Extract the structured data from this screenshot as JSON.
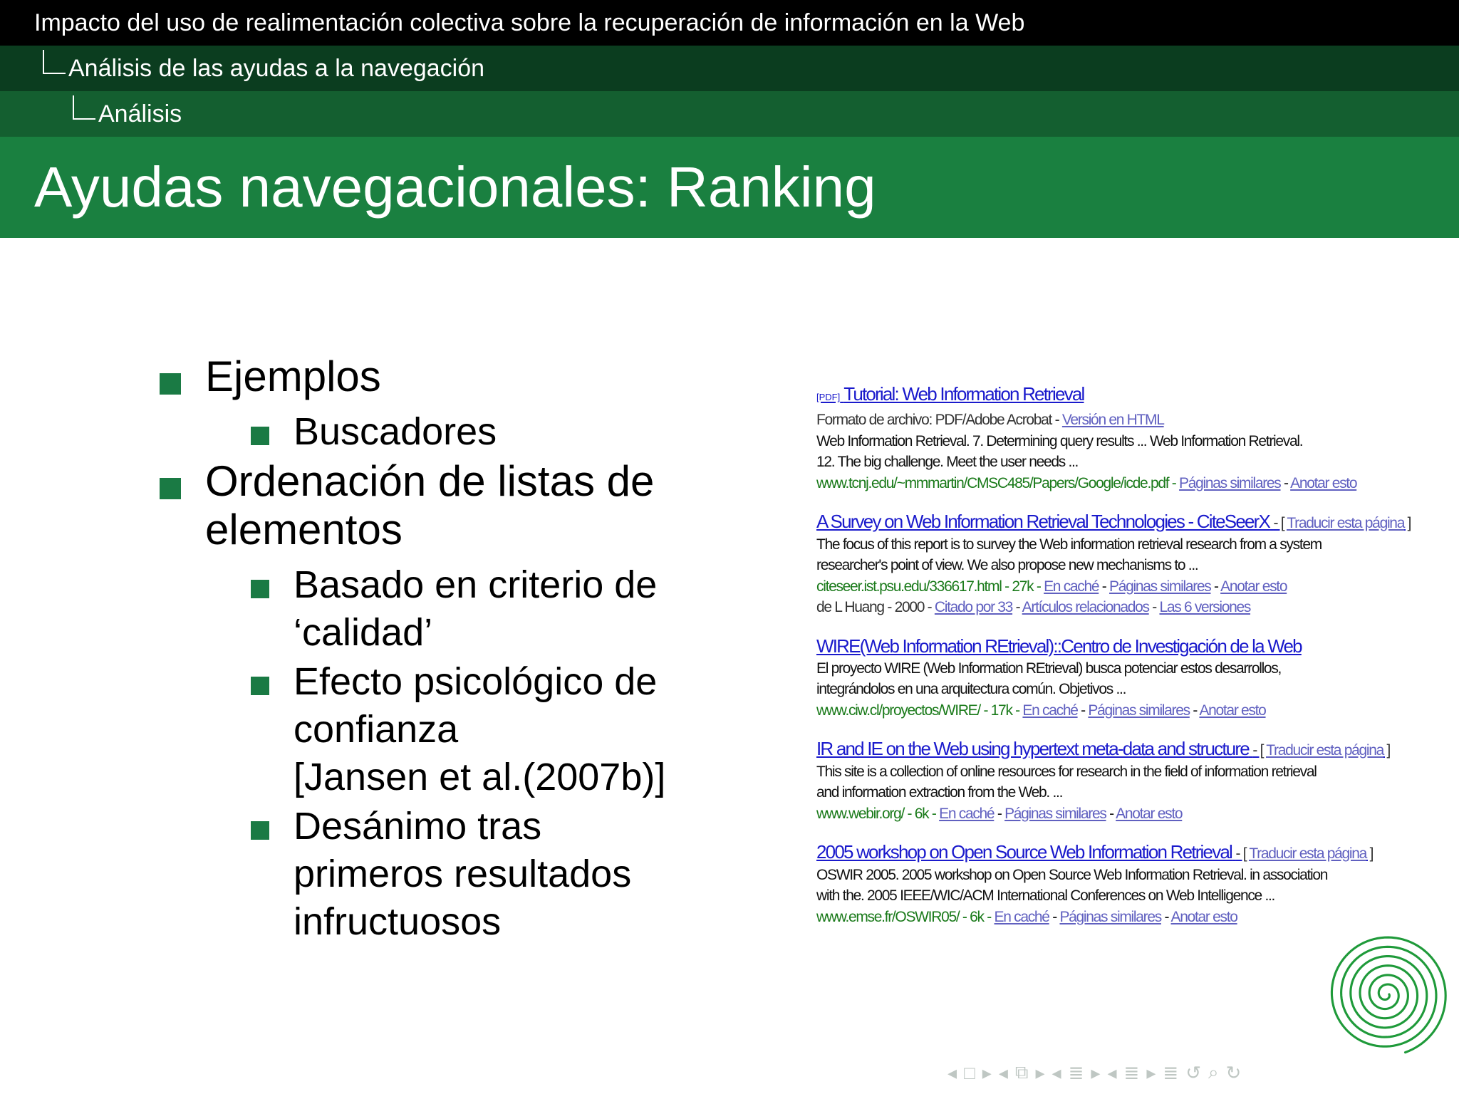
{
  "header": {
    "presentation_title": "Impacto del uso de realimentación colectiva sobre la recuperación de información en la Web",
    "section": "Análisis de las ayudas a la navegación",
    "subsection": "Análisis",
    "frame_title": "Ayudas navegacionales: Ranking"
  },
  "bullets": {
    "b1": "Ejemplos",
    "b1_1": "Buscadores",
    "b2_line1": "Ordenación de listas de",
    "b2_line2": "elementos",
    "b2_1_line1": "Basado en criterio de",
    "b2_1_line2": "‘calidad’",
    "b2_2_line1": "Efecto psicológico de",
    "b2_2_line2": "confianza",
    "b2_2_line3": "[Jansen et al.(2007b)]",
    "b2_3_line1": "Desánimo tras",
    "b2_3_line2": "primeros resultados",
    "b2_3_line3": "infructuosos"
  },
  "search_results": {
    "r1": {
      "pdf_tag": "[PDF]",
      "title": "Tutorial: Web Information Retrieval",
      "format_label": "Formato de archivo: PDF/Adobe Acrobat -",
      "format_link": "Versión en HTML",
      "snippet1": "Web Information Retrieval. 7. Determining query results ... Web Information Retrieval.",
      "snippet2": "12. The big challenge. Meet the user needs ...",
      "url": "www.tcnj.edu/~mmmartin/CMSC485/Papers/Google/icde.pdf -",
      "link1": "Páginas similares",
      "link2": "Anotar esto"
    },
    "r2": {
      "title": "A Survey on Web Information Retrieval Technologies - CiteSeerX",
      "translate": "Traducir esta página",
      "snippet1": "The focus of this report is to survey the Web information retrieval research from a system",
      "snippet2": "researcher's point of view. We also propose new mechanisms to ...",
      "url": "citeseer.ist.psu.edu/336617.html - 27k -",
      "link_cache": "En caché",
      "link1": "Páginas similares",
      "link2": "Anotar esto",
      "meta": "de L Huang - 2000 -",
      "cited": "Citado por 33",
      "related": "Artículos relacionados",
      "versions": "Las 6 versiones"
    },
    "r3": {
      "title": "WIRE(Web Information REtrieval)::Centro de Investigación de la Web",
      "snippet1": "El proyecto WIRE (Web Information REtrieval) busca potenciar estos desarrollos,",
      "snippet2": "integrándolos en una arquitectura común. Objetivos ...",
      "url": "www.ciw.cl/proyectos/WIRE/ - 17k -",
      "link_cache": "En caché",
      "link1": "Páginas similares",
      "link2": "Anotar esto"
    },
    "r4": {
      "title": "IR and IE on the Web using hypertext meta-data and structure",
      "translate": "Traducir esta página",
      "snippet1": "This site is a collection of online resources for research in the field of information retrieval",
      "snippet2": "and information extraction from the Web. ...",
      "url": "www.webir.org/ - 6k -",
      "link_cache": "En caché",
      "link1": "Páginas similares",
      "link2": "Anotar esto"
    },
    "r5": {
      "title": "2005 workshop on Open Source Web Information Retrieval",
      "translate": "Traducir esta página",
      "snippet1": "OSWIR 2005. 2005 workshop on Open Source Web Information Retrieval. in association",
      "snippet2": "with the. 2005 IEEE/WIC/ACM International Conferences on Web Intelligence ...",
      "url": "www.emse.fr/OSWIR05/ - 6k -",
      "link_cache": "En caché",
      "link1": "Páginas similares",
      "link2": "Anotar esto"
    }
  },
  "colors": {
    "header_top": "#000000",
    "header_section": "#0b3d1f",
    "header_subsection": "#145f30",
    "title_bar": "#1a8040",
    "bullet": "#1a7a44",
    "result_link": "#1a1acc",
    "result_url": "#1a7a1a",
    "logo": "#1f9a3a"
  },
  "icons": [
    "spiral-logo-icon",
    "nav-frame-prev-icon",
    "nav-frame-icon",
    "nav-frame-next-icon",
    "nav-subsection-icon",
    "nav-section-icon",
    "nav-appendix-icon",
    "nav-search-icon"
  ]
}
